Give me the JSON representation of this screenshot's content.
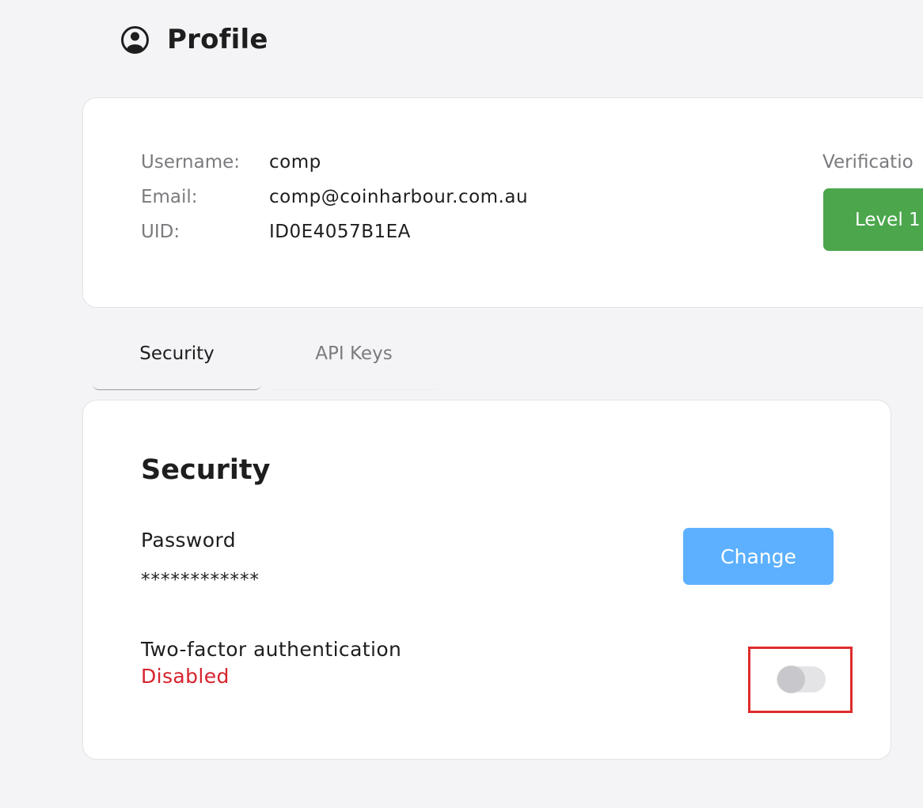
{
  "header": {
    "title": "Profile",
    "icon": "user-circle-icon"
  },
  "profile": {
    "username_label": "Username:",
    "username": "comp",
    "email_label": "Email:",
    "email": "comp@coinharbour.com.au",
    "uid_label": "UID:",
    "uid": "ID0E4057B1EA",
    "verification_label": "Verificatio",
    "level_label": "Level 1",
    "level_color": "#4ba64c"
  },
  "tabs": [
    {
      "label": "Security",
      "active": true
    },
    {
      "label": "API Keys",
      "active": false
    }
  ],
  "security": {
    "title": "Security",
    "password_label": "Password",
    "password_mask": "************",
    "change_label": "Change",
    "change_color": "#5cb0ff",
    "twofa_label": "Two-factor authentication",
    "twofa_status": "Disabled",
    "twofa_status_color": "#d7232c",
    "twofa_enabled": false
  }
}
